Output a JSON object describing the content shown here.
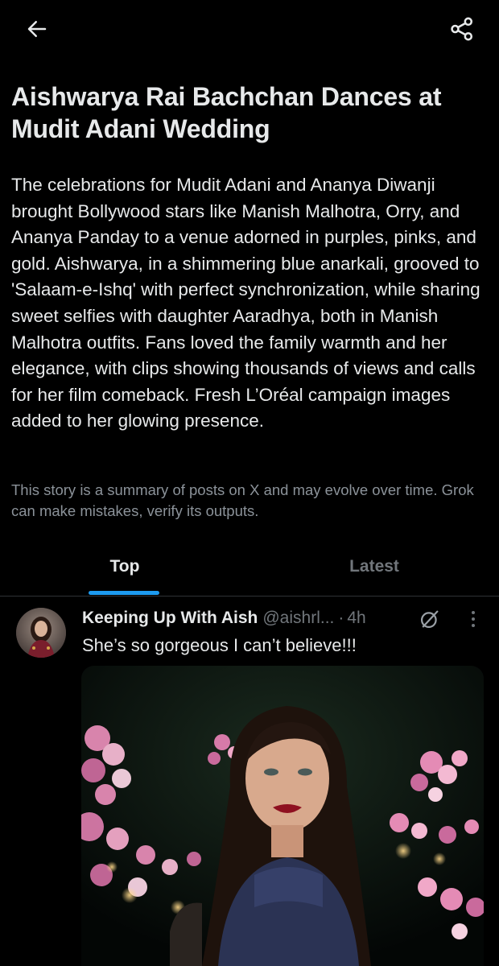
{
  "header": {
    "back_icon": "arrow-left-icon",
    "share_icon": "share-icon"
  },
  "story": {
    "title": "Aishwarya Rai Bachchan Dances at Mudit Adani Wedding",
    "summary": "The celebrations for Mudit Adani and Ananya Diwanji brought Bollywood stars like Manish Malhotra, Orry, and Ananya Panday to a venue adorned in purples, pinks, and gold. Aishwarya, in a shimmering blue anarkali, grooved to 'Salaam-e-Ishq' with perfect synchronization, while sharing sweet selfies with daughter Aaradhya, both in Manish Malhotra outfits. Fans loved the family warmth and her elegance, with clips showing thousands of views and calls for her film comeback. Fresh L’Oréal campaign images added to her glowing presence.",
    "disclaimer": "This story is a summary of posts on X and may evolve over time. Grok can make mistakes, verify its outputs."
  },
  "tabs": [
    {
      "label": "Top",
      "active": true
    },
    {
      "label": "Latest",
      "active": false
    }
  ],
  "post": {
    "author": "Keeping Up With Aish",
    "handle": "@aishrl...",
    "separator": "·",
    "time": "4h",
    "text": "She’s so gorgeous I can’t believe!!!",
    "grok_icon": "grok-icon",
    "more_icon": "more-vertical-icon",
    "media_description_icon": "photo"
  },
  "colors": {
    "background": "#000000",
    "text": "#e7e9ea",
    "secondary": "#71767b",
    "accent": "#1d9bf0"
  }
}
